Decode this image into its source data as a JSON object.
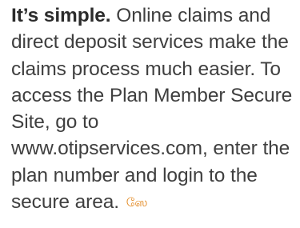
{
  "paragraph": {
    "lead": "It’s simple.",
    "body": "Online claims and direct deposit services make the claims process much easier. To access the Plan Member Secure Site, go to www.otipservices.com, enter the plan number and login to the secure area.",
    "end_mark": "ஸே",
    "end_mark_color": "#e2861c"
  }
}
